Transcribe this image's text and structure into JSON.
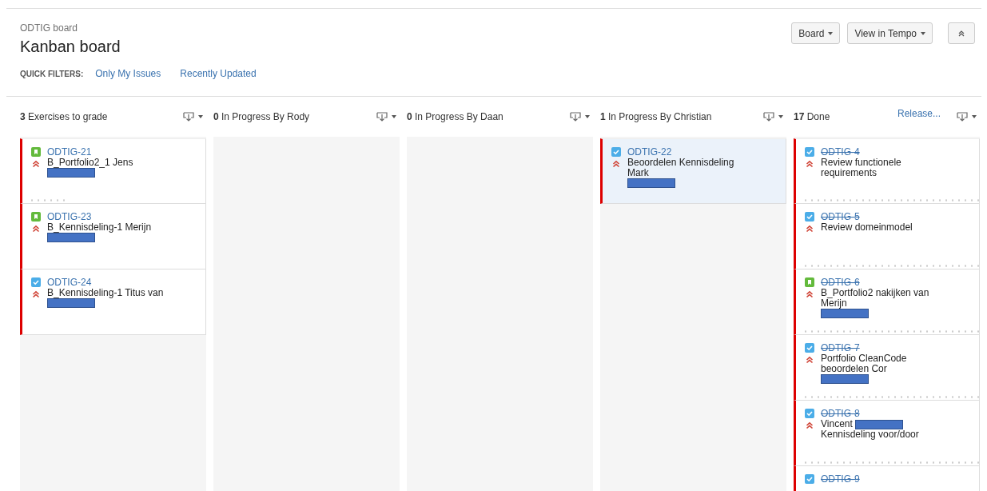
{
  "header": {
    "breadcrumb": "ODTIG board",
    "title": "Kanban board",
    "quick_filters_label": "QUICK FILTERS:",
    "quick_filters": [
      {
        "label": "Only My Issues",
        "selected": false
      },
      {
        "label": "Recently Updated",
        "selected": false
      }
    ],
    "buttons": [
      {
        "label": "Board",
        "kind": "dropdown"
      },
      {
        "label": "View in Tempo",
        "kind": "dropdown"
      },
      {
        "kind": "collapse"
      }
    ]
  },
  "columns": [
    {
      "count": "3",
      "name": "Exercises to grade",
      "cards": [
        {
          "key": "ODTIG-21",
          "kind": "story",
          "done": false,
          "selected": false,
          "high_priority": true,
          "flagged": true,
          "summary": "B_Portfolio2_1 Jens",
          "redacted": true,
          "days_in_column": {
            "level": 0.2
          }
        },
        {
          "key": "ODTIG-23",
          "kind": "story",
          "done": false,
          "selected": false,
          "high_priority": true,
          "flagged": true,
          "summary": "B_Kennisdeling-1 Merijn",
          "redacted": true
        },
        {
          "key": "ODTIG-24",
          "kind": "task",
          "done": false,
          "selected": false,
          "high_priority": true,
          "flagged": true,
          "summary": "B_Kennisdeling-1 Titus van",
          "redacted": true
        }
      ]
    },
    {
      "count": "0",
      "name": "In Progress By Rody"
    },
    {
      "count": "0",
      "name": "In Progress By Daan"
    },
    {
      "count": "1",
      "name": "In Progress By Christian",
      "cards": [
        {
          "key": "ODTIG-22",
          "kind": "task",
          "done": false,
          "selected": true,
          "high_priority": true,
          "flagged": true,
          "summary": "Beoordelen Kennisdeling Mark",
          "redacted": true
        }
      ]
    },
    {
      "count": "17",
      "name": "Done",
      "release": "Release...",
      "cards": [
        {
          "key": "ODTIG-4",
          "kind": "task",
          "done": true,
          "selected": false,
          "high_priority": true,
          "flagged": true,
          "summary": "Review functionele requirements",
          "days_in_column": {
            "level": 1
          }
        },
        {
          "key": "ODTIG-5",
          "kind": "task",
          "done": true,
          "selected": false,
          "high_priority": true,
          "flagged": true,
          "summary": "Review domeinmodel",
          "days_in_column": {
            "level": 1
          }
        },
        {
          "key": "ODTIG-6",
          "kind": "story",
          "done": true,
          "selected": false,
          "high_priority": true,
          "flagged": true,
          "summary": "B_Portfolio2 nakijken van Merijn",
          "redacted": true,
          "days_in_column": {
            "level": 1
          }
        },
        {
          "key": "ODTIG-7",
          "kind": "task",
          "done": true,
          "selected": false,
          "high_priority": true,
          "flagged": true,
          "summary": "Portfolio CleanCode beoordelen Cor",
          "redacted": true,
          "days_in_column": {
            "level": 1
          }
        },
        {
          "key": "ODTIG-8",
          "kind": "task",
          "done": true,
          "selected": false,
          "high_priority": true,
          "flagged": true,
          "summary": "Vincent",
          "redacted": true,
          "summary_after": "Kennisdeling voor/door",
          "days_in_column": {
            "level": 1
          }
        },
        {
          "key": "ODTIG-9",
          "kind": "task",
          "done": true,
          "selected": false,
          "flagged": true
        }
      ]
    }
  ]
}
